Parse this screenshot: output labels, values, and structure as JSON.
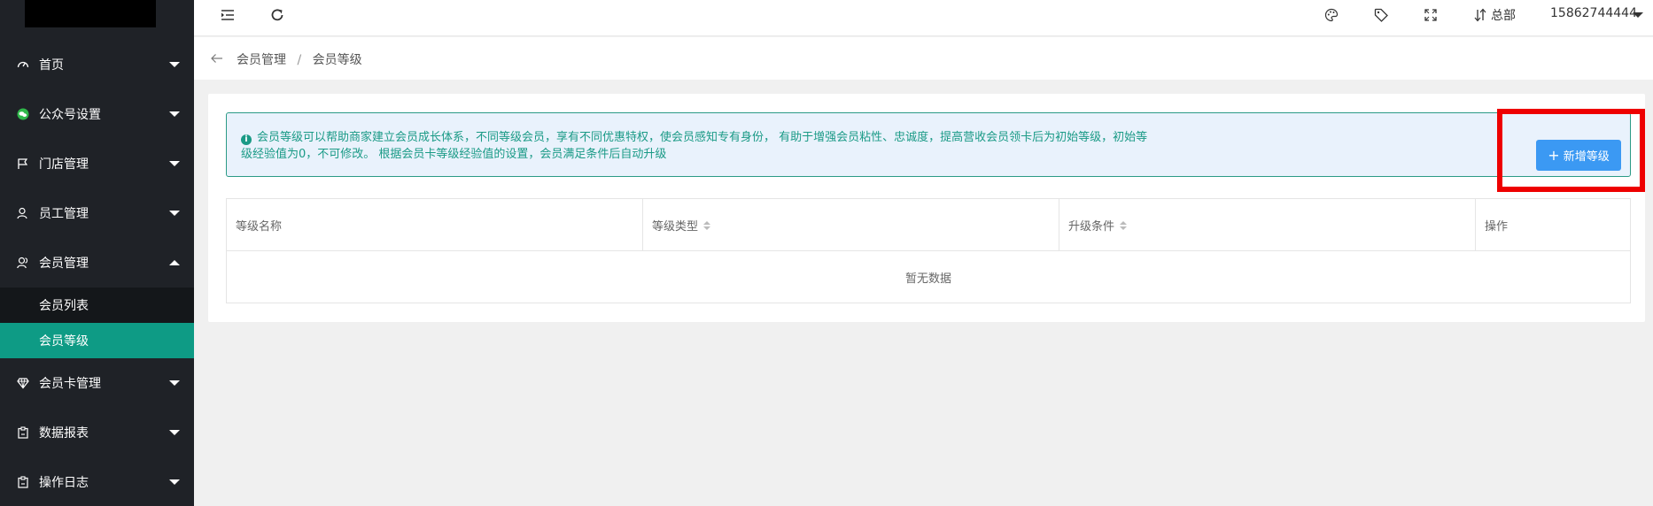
{
  "sidebar": {
    "items": [
      {
        "label": "首页",
        "icon": "dashboard-icon"
      },
      {
        "label": "公众号设置",
        "icon": "wechat-icon"
      },
      {
        "label": "门店管理",
        "icon": "flag-icon"
      },
      {
        "label": "员工管理",
        "icon": "user-icon"
      },
      {
        "label": "会员管理",
        "icon": "users-icon"
      },
      {
        "label": "会员卡管理",
        "icon": "diamond-icon"
      },
      {
        "label": "数据报表",
        "icon": "clipboard-icon"
      },
      {
        "label": "操作日志",
        "icon": "clipboard-icon"
      }
    ],
    "submenu": [
      {
        "label": "会员列表"
      },
      {
        "label": "会员等级"
      }
    ],
    "active_color": "#0e9b85"
  },
  "topbar": {
    "store": "总部",
    "account": "15862744444"
  },
  "breadcrumb": {
    "parent": "会员管理",
    "separator": "/",
    "current": "会员等级"
  },
  "notice": {
    "text_line1": "会员等级可以帮助商家建立会员成长体系，不同等级会员，享有不同优惠特权，使会员感知专有身份， 有助于增强会员粘性、忠诚度，提高营收会员领卡后为初始等级，初始等",
    "text_line2": "级经验值为0，不可修改。 根据会员卡等级经验值的设置，会员满足条件后自动升级"
  },
  "actions": {
    "add_label": "新增等级"
  },
  "table": {
    "columns": [
      "等级名称",
      "等级类型",
      "升级条件",
      "操作"
    ],
    "empty_text": "暂无数据"
  }
}
